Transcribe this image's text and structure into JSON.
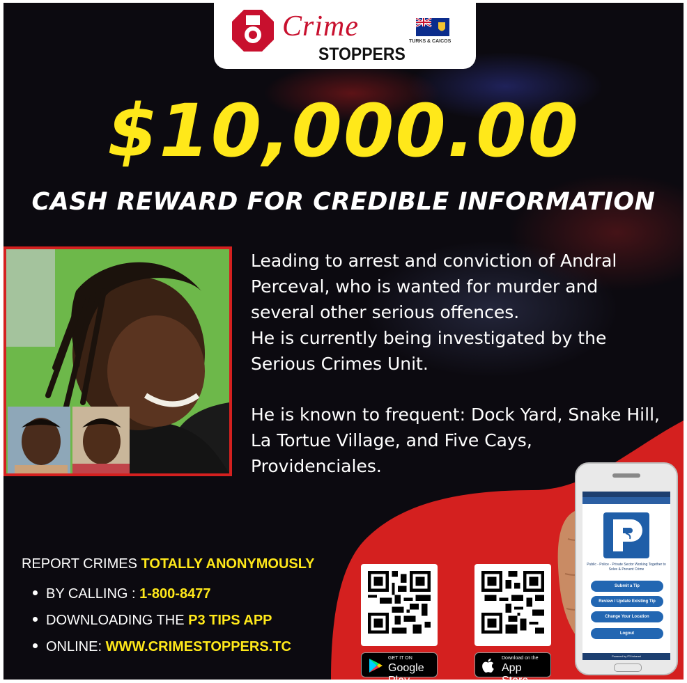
{
  "logo": {
    "crime": "Crime",
    "stoppers": "STOPPERS",
    "flag_caption": "TURKS & CAICOS"
  },
  "headline": {
    "amount": "$10,000.00",
    "subtitle": "CASH REWARD FOR CREDIBLE INFORMATION"
  },
  "description": {
    "line1": "Leading to arrest and conviction of Andral Perceval, who is wanted for murder and several other serious offences.",
    "line2": "He is currently being investigated by the Serious Crimes Unit.",
    "line3": "He is known to frequent: Dock Yard, Snake Hill, La Tortue Village, and Five Cays, Providenciales."
  },
  "report": {
    "heading_prefix": "REPORT CRIMES",
    "heading_highlight": "TOTALLY ANONYMOUSLY",
    "methods": [
      {
        "prefix": "BY CALLING :",
        "highlight": "1-800-8477"
      },
      {
        "prefix": "DOWNLOADING THE",
        "highlight": "P3 TIPS APP"
      },
      {
        "prefix": "ONLINE:",
        "highlight": "WWW.CRIMESTOPPERS.TC"
      }
    ]
  },
  "badges": {
    "google_small": "GET IT ON",
    "google_big": "Google Play",
    "apple_small": "Download on the",
    "apple_big": "App Store"
  },
  "phone": {
    "tagline": "Public - Police - Private Sector Working Together to Solve & Prevent Crime",
    "buttons": [
      "Submit a Tip",
      "Review / Update Existing Tip",
      "Change Your Location",
      "Logout"
    ],
    "footer": "Powered by P3 Intranet"
  },
  "colors": {
    "accent_yellow": "#ffe81a",
    "accent_red": "#d4201f",
    "background": "#0c0a10",
    "app_blue": "#2266b2"
  }
}
